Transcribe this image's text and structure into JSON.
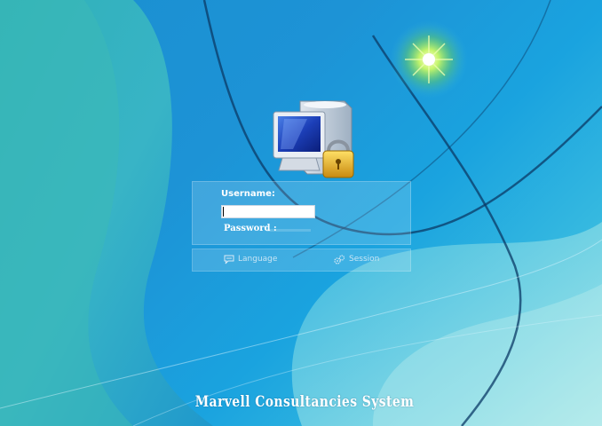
{
  "login": {
    "username_label": "Username:",
    "username_value": "",
    "password_label": "Password :"
  },
  "options": {
    "language_label": "Language",
    "session_label": "Session"
  },
  "branding": {
    "title": "Marvell Consultancies System"
  },
  "icons": {
    "login": "computer-with-padlock-icon",
    "language": "speech-bubble-icon",
    "session": "gears-icon"
  },
  "colors": {
    "background_primary": "#1a8fd0",
    "background_light": "#7fd8e6",
    "text": "#ffffff"
  }
}
